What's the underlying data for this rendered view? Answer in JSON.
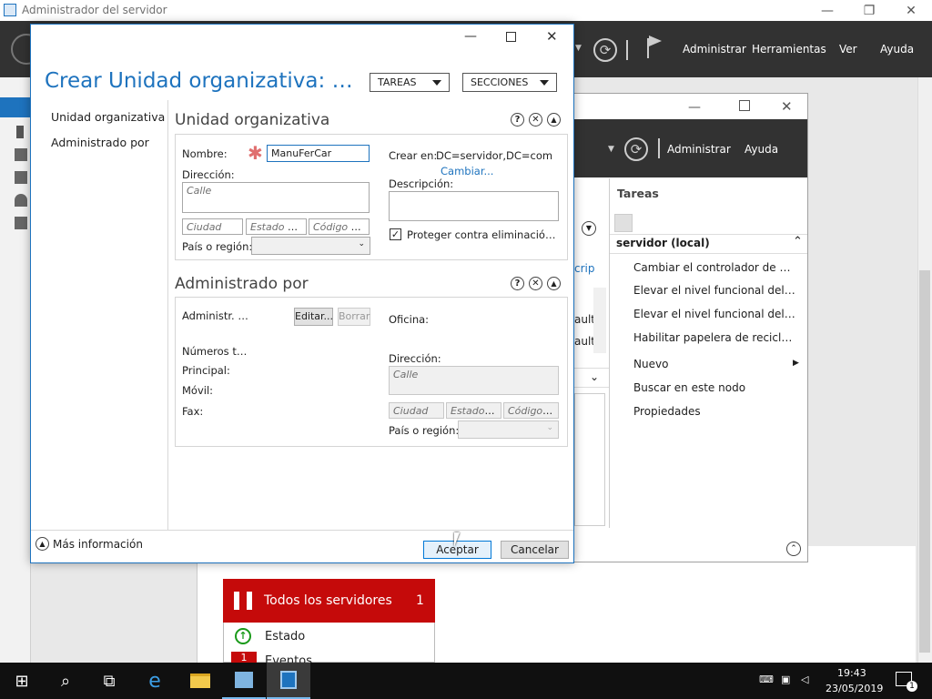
{
  "server_manager": {
    "title": "Administrador del servidor",
    "menu": [
      "Administrar",
      "Herramientas",
      "Ver",
      "Ayuda"
    ]
  },
  "ad_window": {
    "menu": [
      "Administrar",
      "Ayuda"
    ],
    "tasks_title": "Tareas",
    "node_title": "servidor (local)",
    "tasks": [
      "Cambiar el controlador de do...",
      "Elevar el nivel funcional del bo...",
      "Elevar el nivel funcional del do...",
      "Habilitar papelera de reciclaje...",
      "Nuevo",
      "Buscar en este nodo",
      "Propiedades"
    ],
    "partial_texts": [
      "crip",
      "ault",
      "ault"
    ]
  },
  "tile": {
    "title": "Todos los servidores",
    "count": "1",
    "status_label": "Estado",
    "events_label": "Eventos",
    "events_count": "1"
  },
  "dialog": {
    "title": "Crear Unidad organizativa: Manu...",
    "tasks_label": "TAREAS",
    "sections_label": "SECCIONES",
    "nav": [
      "Unidad organizativa",
      "Administrado por"
    ],
    "ou_section": {
      "heading": "Unidad organizativa",
      "name_label": "Nombre:",
      "name_value": "ManuFerCar",
      "address_label": "Dirección:",
      "street_placeholder": "Calle",
      "city_placeholder": "Ciudad",
      "state_placeholder": "Estado o p...",
      "zip_placeholder": "Código po...",
      "country_label": "País o región:",
      "create_in_label": "Crear en:",
      "create_in_value": "DC=servidor,DC=com",
      "change_link": "Cambiar...",
      "description_label": "Descripción:",
      "protect_label": "Proteger contra eliminación a...",
      "protect_checked": true
    },
    "managed_section": {
      "heading": "Administrado por",
      "managed_by_label": "Administr. por",
      "edit_button": "Editar...",
      "clear_button": "Borrar",
      "office_label": "Oficina:",
      "phones_label": "Números telé",
      "main_label": "Principal:",
      "mobile_label": "Móvil:",
      "fax_label": "Fax:",
      "address_label": "Dirección:",
      "street_placeholder": "Calle",
      "city_placeholder": "Ciudad",
      "state_placeholder": "Estado o...",
      "zip_placeholder": "Código p...",
      "country_label": "País o región:"
    },
    "more_info": "Más información",
    "ok_button": "Aceptar",
    "cancel_button": "Cancelar"
  },
  "taskbar": {
    "time": "19:43",
    "date": "23/05/2019",
    "notification_count": "1"
  }
}
